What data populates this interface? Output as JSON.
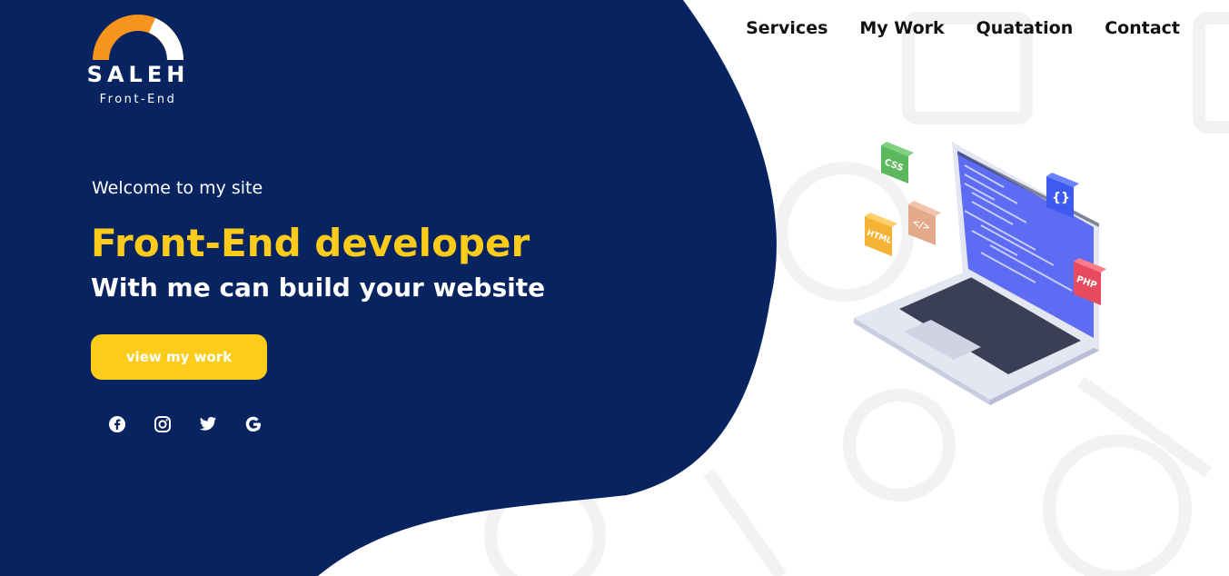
{
  "brand": {
    "name": "SALEH",
    "tagline": "Front-End"
  },
  "nav": {
    "items": [
      "Services",
      "My Work",
      "Quatation",
      "Contact"
    ]
  },
  "hero": {
    "welcome": "Welcome to my site",
    "headline": "Front-End developer",
    "subline": "With me can build your website",
    "cta_label": "view my work"
  },
  "socials": [
    {
      "icon": "facebook-icon"
    },
    {
      "icon": "instagram-icon"
    },
    {
      "icon": "twitter-icon"
    },
    {
      "icon": "google-icon"
    }
  ],
  "illustration": {
    "badges": [
      "CSS",
      "HTML",
      "</>",
      "{}",
      "PHP"
    ]
  },
  "colors": {
    "navy": "#072461",
    "accent": "#fdcc1b",
    "logo_orange": "#f7941d"
  }
}
